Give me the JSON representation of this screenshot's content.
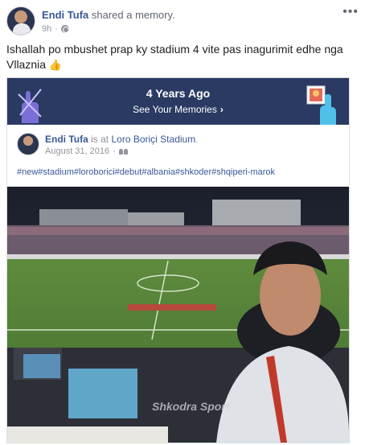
{
  "post": {
    "author": "Endi Tufa",
    "action": "shared a memory.",
    "time": "9h",
    "separator": "·",
    "text": "Ishallah po mbushet prap ky stadium 4 vite pas inagurimit edhe nga Vllaznia",
    "more_icon": "more-horizontal-icon",
    "privacy_icon": "globe-icon"
  },
  "memory": {
    "title": "4 Years Ago",
    "link_label": "See Your Memories",
    "link_icon": "chevron-right-icon"
  },
  "original_post": {
    "author": "Endi Tufa",
    "action": "is at",
    "place": "Loro Boriçi Stadium",
    "place_suffix": ".",
    "date": "August 31, 2016",
    "separator": "·",
    "audience_icon": "friends-icon",
    "hashtags": "#new#stadium#loroborici#debut#albania#shkoder#shqiperi-marok",
    "photo_watermark": "Shkodra Sport"
  },
  "colors": {
    "link_blue": "#385898",
    "banner_bg": "#2b3a63",
    "muted": "#90949c"
  }
}
